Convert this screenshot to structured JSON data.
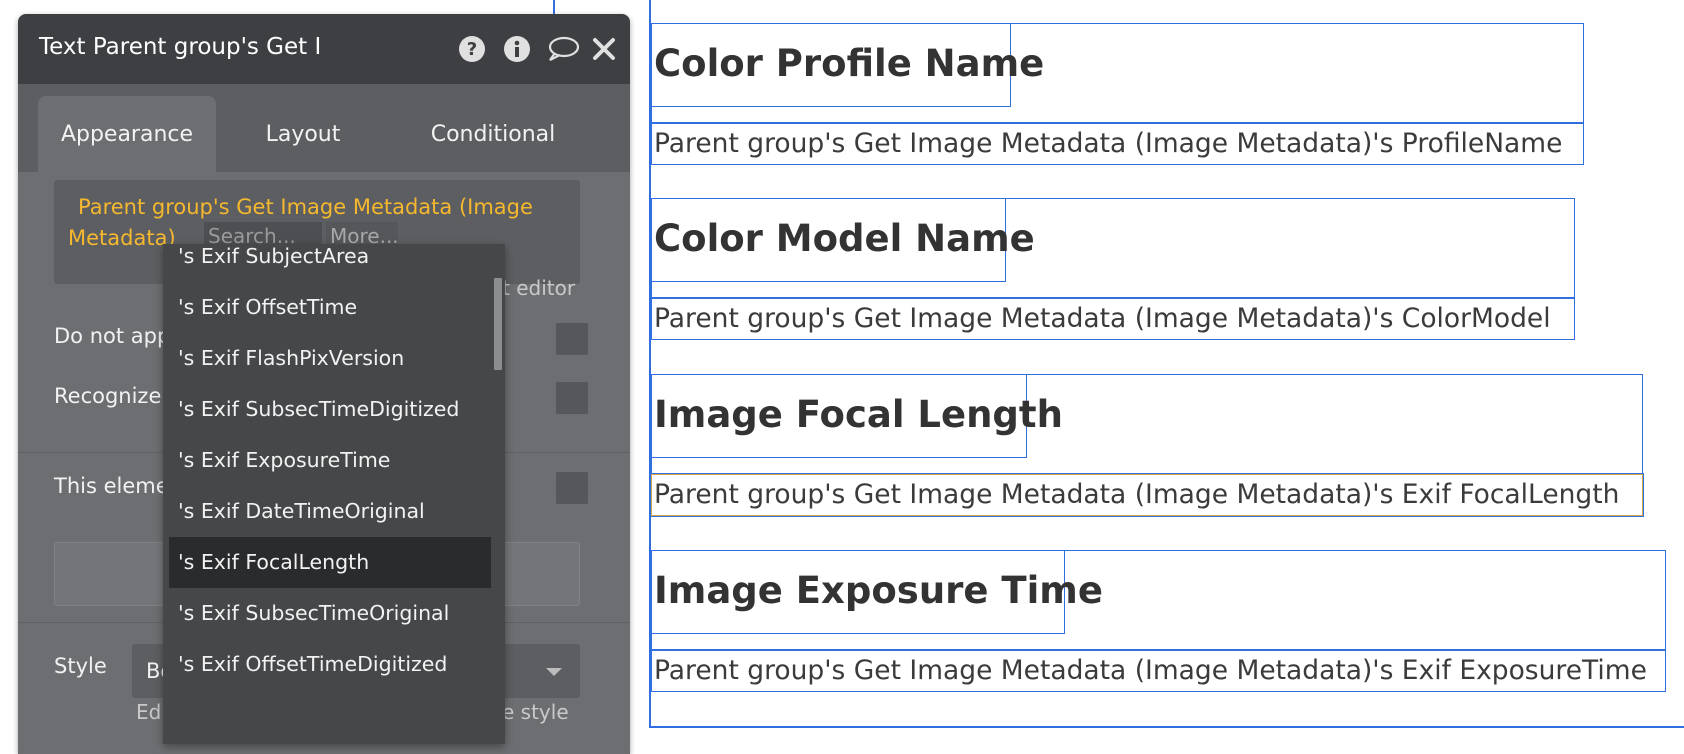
{
  "panel": {
    "title": "Text Parent group's Get I",
    "icons": [
      "help-icon",
      "info-icon",
      "comment-icon",
      "close-icon"
    ],
    "tabs": [
      "Appearance",
      "Layout",
      "Conditional"
    ],
    "active_tab": "Appearance",
    "expression_line1": "Parent group's Get Image Metadata (Image",
    "expression_line2": "Metadata)",
    "search_placeholder": "Search...",
    "more_label": "More...",
    "editor_link_partial": "t editor",
    "row_do_not_apply": "Do not appl",
    "row_recognize": "Recognize li",
    "row_this_element": "This elemen",
    "style_label": "Style",
    "style_value": "Bo",
    "edit_style_partial": "Ed",
    "style_hint_partial": "e style"
  },
  "dropdown": {
    "items": [
      "'s Exif SubjectArea",
      "'s Exif OffsetTime",
      "'s Exif FlashPixVersion",
      "'s Exif SubsecTimeDigitized",
      "'s Exif ExposureTime",
      "'s Exif DateTimeOriginal",
      "'s Exif FocalLength",
      "'s Exif SubsecTimeOriginal",
      "'s Exif OffsetTimeDigitized"
    ],
    "highlighted": "'s Exif FocalLength"
  },
  "canvas": {
    "sections": [
      {
        "heading": "Color Profile Name",
        "text": "Parent group's Get Image Metadata (Image Metadata)'s ProfileName"
      },
      {
        "heading": "Color Model Name",
        "text": "Parent group's Get Image Metadata (Image Metadata)'s ColorModel"
      },
      {
        "heading": "Image Focal Length",
        "text": "Parent group's Get Image Metadata (Image Metadata)'s Exif FocalLength"
      },
      {
        "heading": "Image Exposure Time",
        "text": "Parent group's Get Image Metadata (Image Metadata)'s Exif ExposureTime"
      }
    ]
  },
  "colors": {
    "selection_blue": "#2f6fe0",
    "expression_yellow": "#f5b82e",
    "panel_bg": "#6c6e71",
    "panel_header": "#3d3f42"
  }
}
